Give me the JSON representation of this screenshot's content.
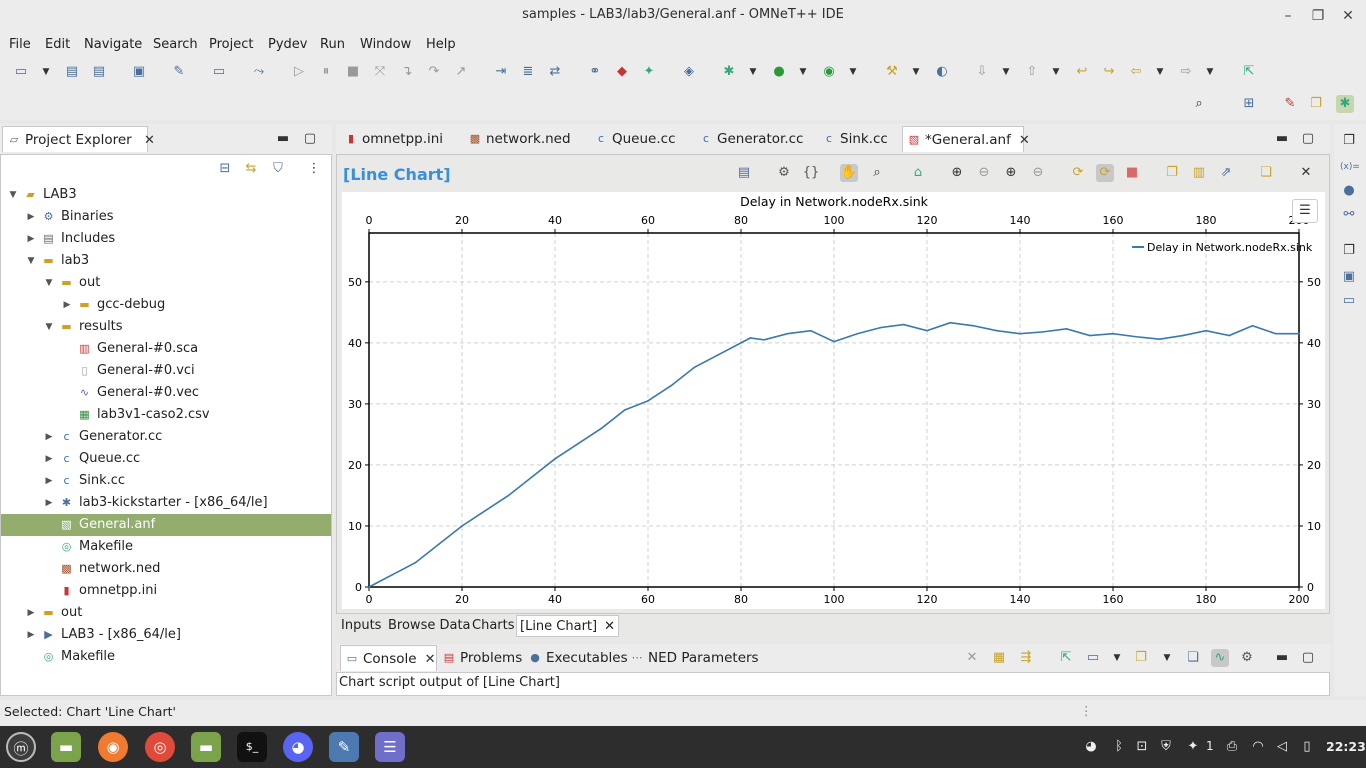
{
  "window": {
    "title": "samples - LAB3/lab3/General.anf - OMNeT++ IDE",
    "minimize": "–",
    "maximize": "❐",
    "close": "✕"
  },
  "menu": [
    "File",
    "Edit",
    "Navigate",
    "Search",
    "Project",
    "Pydev",
    "Run",
    "Window",
    "Help"
  ],
  "project_explorer": {
    "tab_label": "Project Explorer",
    "tree": [
      {
        "label": "LAB3",
        "depth": 0,
        "arrow": "down",
        "icon": "project-icon"
      },
      {
        "label": "Binaries",
        "depth": 1,
        "arrow": "right",
        "icon": "binaries-icon"
      },
      {
        "label": "Includes",
        "depth": 1,
        "arrow": "right",
        "icon": "includes-icon"
      },
      {
        "label": "lab3",
        "depth": 1,
        "arrow": "down",
        "icon": "folder-icon"
      },
      {
        "label": "out",
        "depth": 2,
        "arrow": "down",
        "icon": "folder-icon"
      },
      {
        "label": "gcc-debug",
        "depth": 3,
        "arrow": "right",
        "icon": "folder-icon"
      },
      {
        "label": "results",
        "depth": 2,
        "arrow": "down",
        "icon": "folder-icon"
      },
      {
        "label": "General-#0.sca",
        "depth": 3,
        "arrow": "",
        "icon": "scalar-file-icon"
      },
      {
        "label": "General-#0.vci",
        "depth": 3,
        "arrow": "",
        "icon": "file-icon"
      },
      {
        "label": "General-#0.vec",
        "depth": 3,
        "arrow": "",
        "icon": "vector-file-icon"
      },
      {
        "label": "lab3v1-caso2.csv",
        "depth": 3,
        "arrow": "",
        "icon": "csv-file-icon"
      },
      {
        "label": "Generator.cc",
        "depth": 2,
        "arrow": "right",
        "icon": "cc-file-icon"
      },
      {
        "label": "Queue.cc",
        "depth": 2,
        "arrow": "right",
        "icon": "cc-file-icon"
      },
      {
        "label": "Sink.cc",
        "depth": 2,
        "arrow": "right",
        "icon": "cc-file-icon"
      },
      {
        "label": "lab3-kickstarter - [x86_64/le]",
        "depth": 2,
        "arrow": "right",
        "icon": "executable-icon"
      },
      {
        "label": "General.anf",
        "depth": 2,
        "arrow": "",
        "icon": "anf-file-icon",
        "selected": true
      },
      {
        "label": "Makefile",
        "depth": 2,
        "arrow": "",
        "icon": "makefile-icon"
      },
      {
        "label": "network.ned",
        "depth": 2,
        "arrow": "",
        "icon": "ned-file-icon"
      },
      {
        "label": "omnetpp.ini",
        "depth": 2,
        "arrow": "",
        "icon": "ini-file-icon"
      },
      {
        "label": "out",
        "depth": 1,
        "arrow": "right",
        "icon": "folder-icon"
      },
      {
        "label": "LAB3 - [x86_64/le]",
        "depth": 1,
        "arrow": "right",
        "icon": "launch-icon"
      },
      {
        "label": "Makefile",
        "depth": 1,
        "arrow": "",
        "icon": "makefile-icon"
      }
    ]
  },
  "editor_tabs": [
    {
      "label": "omnetpp.ini",
      "icon": "ini-file-icon"
    },
    {
      "label": "network.ned",
      "icon": "ned-file-icon"
    },
    {
      "label": "Queue.cc",
      "icon": "cc-file-icon"
    },
    {
      "label": "Generator.cc",
      "icon": "cc-file-icon"
    },
    {
      "label": "Sink.cc",
      "icon": "cc-file-icon"
    },
    {
      "label": "*General.anf",
      "icon": "anf-file-icon",
      "active": true
    }
  ],
  "chart_editor": {
    "heading": "[Line Chart]",
    "bottom_tabs": [
      "Inputs",
      "Browse Data",
      "Charts",
      "[Line Chart]"
    ]
  },
  "chart_data": {
    "type": "line",
    "title": "Delay in Network.nodeRx.sink",
    "xlabel": "",
    "ylabel": "",
    "xlim": [
      0,
      200
    ],
    "ylim": [
      0,
      58
    ],
    "xticks": [
      0,
      20,
      40,
      60,
      80,
      100,
      120,
      140,
      160,
      180,
      200
    ],
    "yticks": [
      0,
      10,
      20,
      30,
      40,
      50
    ],
    "grid": true,
    "legend": "top-right",
    "series": [
      {
        "name": "Delay in Network.nodeRx.sink",
        "color": "#3a78ad",
        "x": [
          0,
          5,
          10,
          15,
          20,
          25,
          30,
          35,
          40,
          45,
          50,
          55,
          60,
          65,
          70,
          75,
          80,
          82,
          85,
          90,
          95,
          100,
          105,
          110,
          115,
          120,
          125,
          130,
          135,
          140,
          145,
          150,
          155,
          160,
          165,
          170,
          175,
          180,
          185,
          190,
          195,
          200
        ],
        "y": [
          0,
          2,
          4,
          7,
          10,
          12.5,
          15,
          18,
          21,
          23.5,
          26,
          29,
          30.5,
          33,
          36,
          38,
          40,
          40.8,
          40.5,
          41.5,
          42,
          40.2,
          41.5,
          42.5,
          43,
          42,
          43.3,
          42.8,
          42,
          41.5,
          41.8,
          42.3,
          41.2,
          41.5,
          41,
          40.6,
          41.2,
          42,
          41.2,
          42.8,
          41.5,
          41.5
        ]
      }
    ]
  },
  "console": {
    "tabs": [
      "Console",
      "Problems",
      "Executables",
      "NED Parameters"
    ],
    "output": "Chart script output of [Line Chart]"
  },
  "status": {
    "text": "Selected: Chart 'Line Chart'"
  },
  "tray": {
    "count": "1",
    "time": "22:23"
  }
}
